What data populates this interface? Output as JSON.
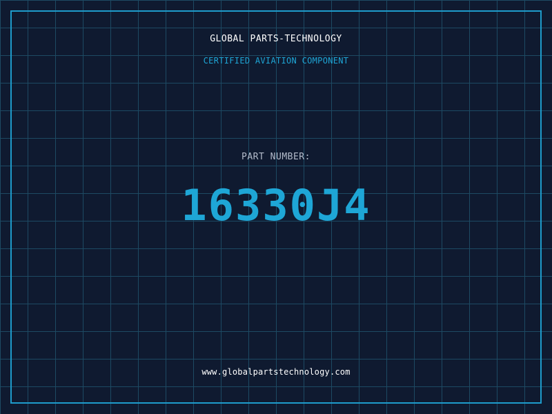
{
  "brand": {
    "title": "GLOBAL PARTS-TECHNOLOGY",
    "subtitle": "CERTIFIED AVIATION COMPONENT"
  },
  "part": {
    "label": "PART NUMBER:",
    "value": "16330J4"
  },
  "footer": {
    "website": "www.globalpartstechnology.com"
  },
  "colors": {
    "background": "#0f1a30",
    "grid": "#1d4a63",
    "accent": "#1ea6d6",
    "text_primary": "#ffffff",
    "text_muted": "#b4bccb"
  }
}
